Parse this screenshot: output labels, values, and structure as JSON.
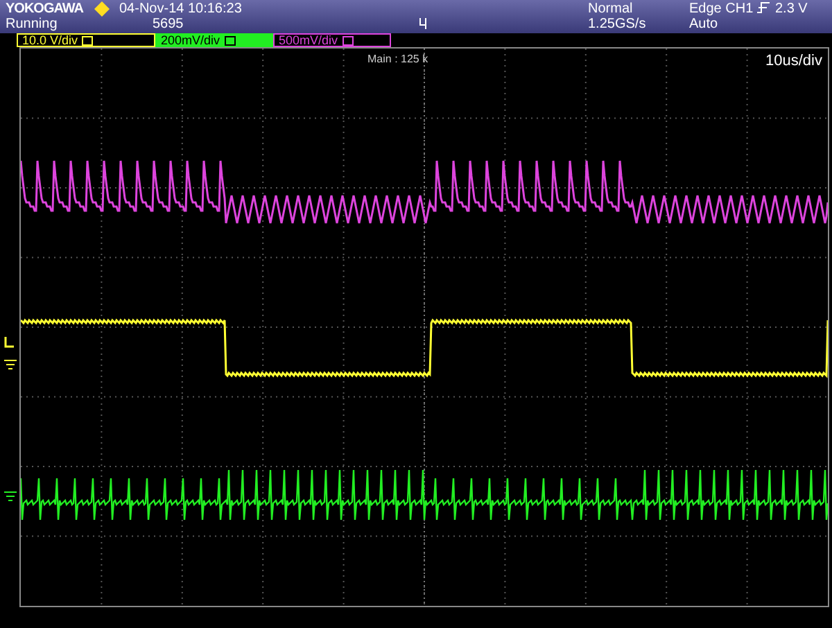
{
  "header": {
    "brand": "YOKOGAWA",
    "datetime": "04-Nov-14 10:16:23",
    "run_state": "Running",
    "acquisition_count": "5695",
    "mode": "Normal",
    "sample_rate": "1.25GS/s",
    "trigger_source": "Edge CH1",
    "trigger_level": "2.3 V",
    "trigger_mode": "Auto"
  },
  "channels": [
    {
      "scale": "10.0 V/div",
      "color": "#ffff33",
      "selected": false
    },
    {
      "scale": "200mV/div",
      "color": "#22ee22",
      "selected": true
    },
    {
      "scale": "500mV/div",
      "color": "#dd44dd",
      "selected": false
    }
  ],
  "screen": {
    "zoom_label": "Main : 125 k",
    "timebase": "10us/div"
  }
}
